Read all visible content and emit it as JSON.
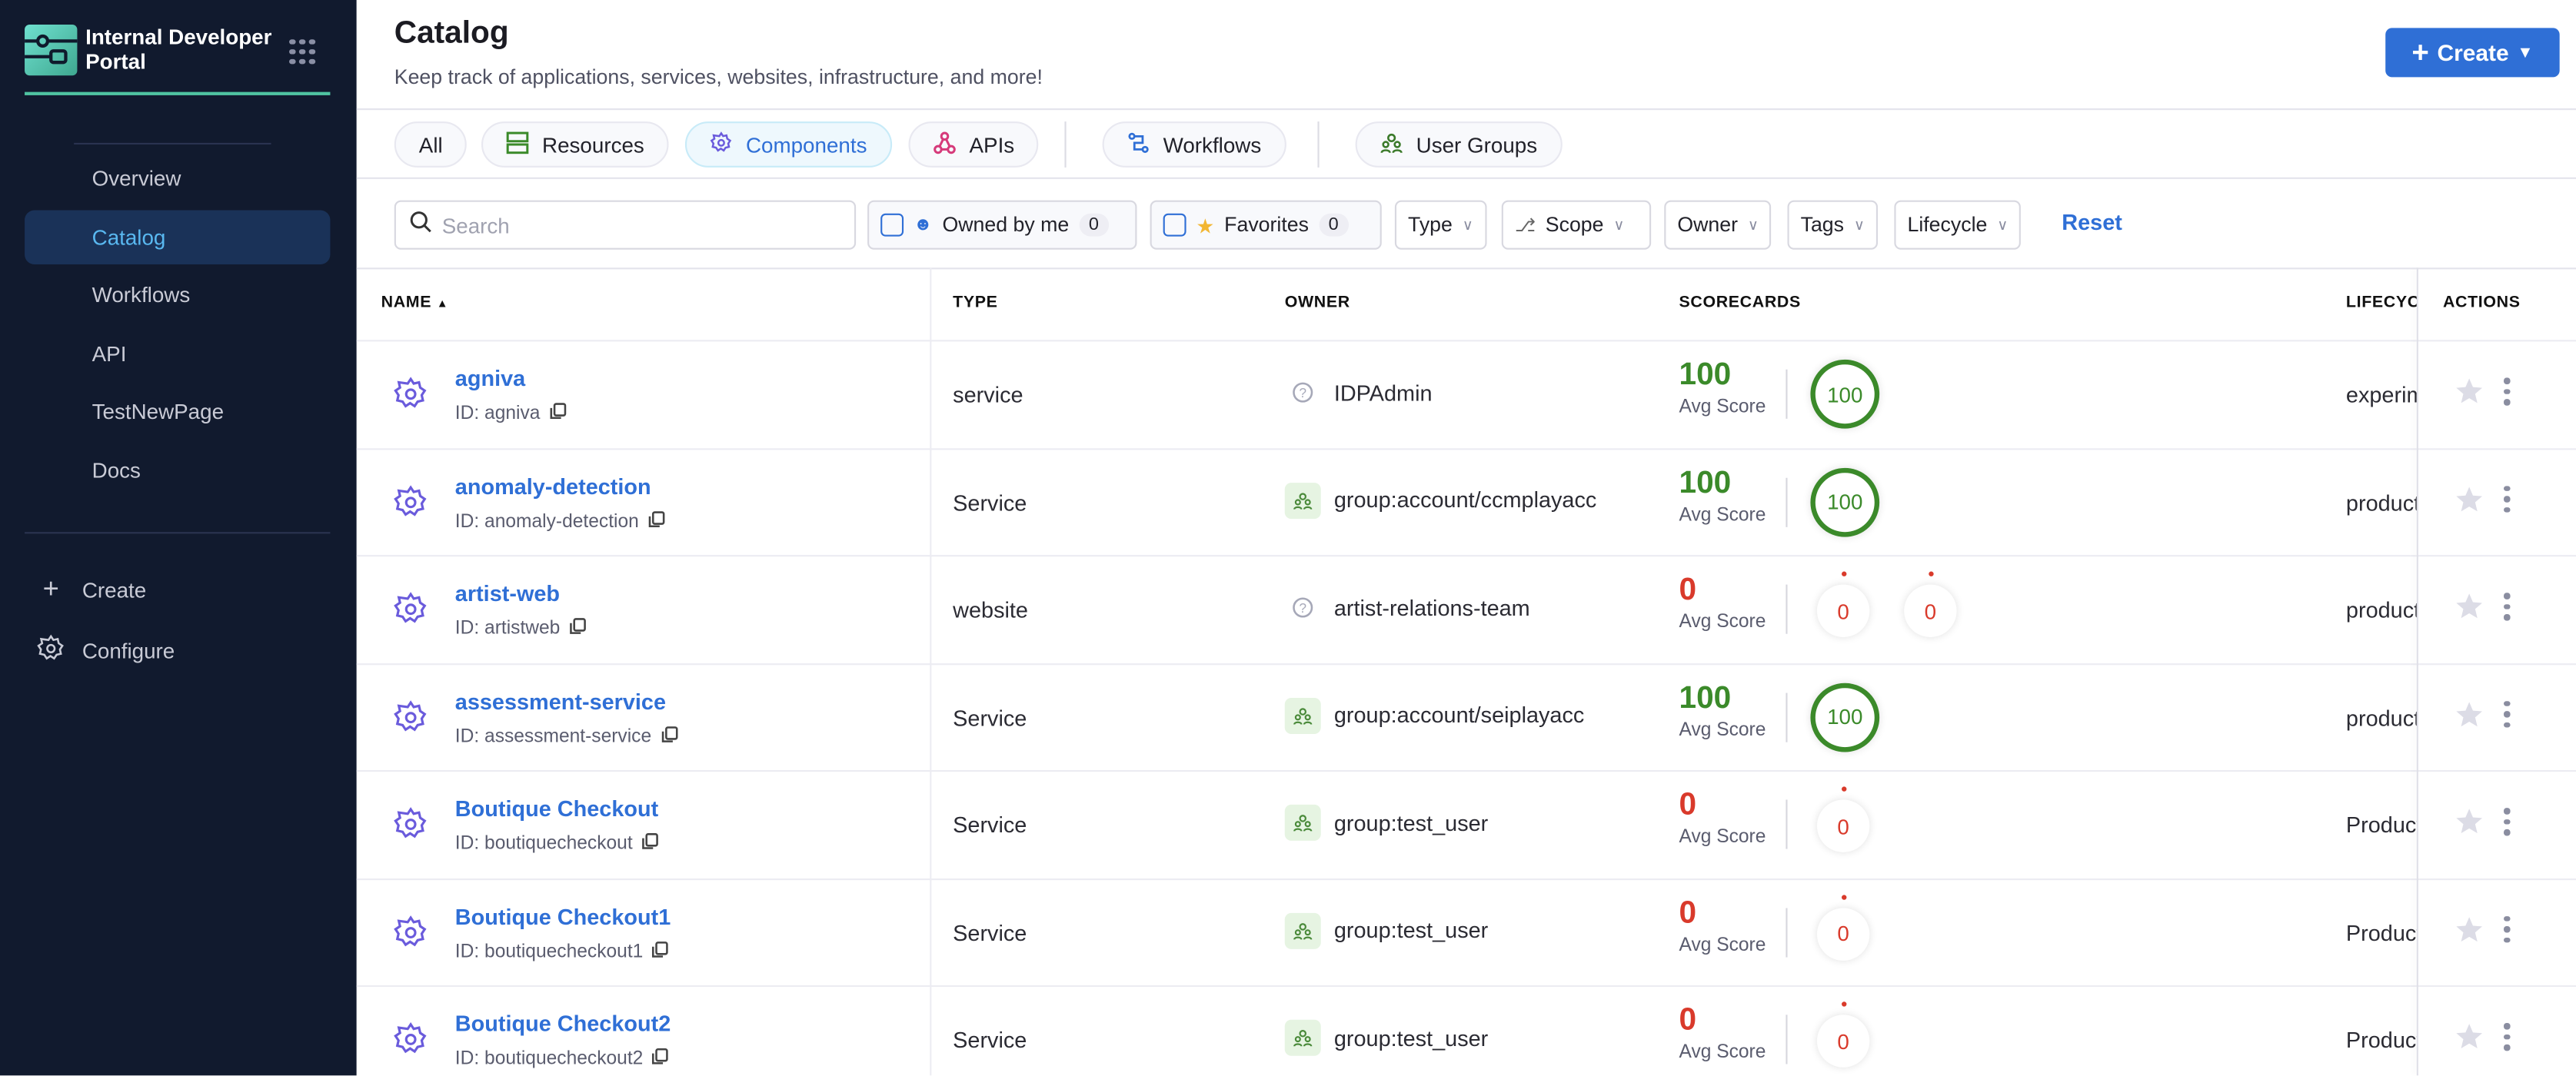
{
  "sidebar": {
    "brand": "Internal Developer Portal",
    "items": [
      {
        "label": "Overview"
      },
      {
        "label": "Catalog",
        "active": true
      },
      {
        "label": "Workflows"
      },
      {
        "label": "API"
      },
      {
        "label": "TestNewPage"
      },
      {
        "label": "Docs"
      }
    ],
    "create_label": "Create",
    "configure_label": "Configure"
  },
  "header": {
    "title": "Catalog",
    "subtitle": "Keep track of applications, services, websites, infrastructure, and more!",
    "create_label": "Create"
  },
  "tabs": [
    {
      "label": "All"
    },
    {
      "label": "Resources",
      "icon": "resources-icon"
    },
    {
      "label": "Components",
      "icon": "gear-icon",
      "active": true
    },
    {
      "label": "APIs",
      "icon": "api-icon"
    },
    {
      "label": "Workflows",
      "icon": "workflow-icon"
    },
    {
      "label": "User Groups",
      "icon": "users-icon"
    }
  ],
  "filters": {
    "search_placeholder": "Search",
    "owned_label": "Owned by me",
    "owned_count": "0",
    "fav_label": "Favorites",
    "fav_count": "0",
    "type": "Type",
    "scope": "Scope",
    "owner": "Owner",
    "tags": "Tags",
    "lifecycle": "Lifecycle",
    "reset": "Reset"
  },
  "table": {
    "columns": {
      "name": "NAME",
      "type": "TYPE",
      "owner": "OWNER",
      "scorecards": "SCORECARDS",
      "lifecycle": "LIFECYC",
      "actions": "ACTIONS"
    },
    "avg_label": "Avg Score",
    "colors": {
      "good": "#3b8a2a",
      "bad": "#d93a2b"
    },
    "rows": [
      {
        "name": "agniva",
        "id": "ID: agniva",
        "type": "service",
        "owner": "IDPAdmin",
        "owner_kind": "unknown",
        "avg": "100",
        "scores": [
          "100"
        ],
        "lifecycle": "experimental"
      },
      {
        "name": "anomaly-detection",
        "id": "ID: anomaly-detection",
        "type": "Service",
        "owner": "group:account/ccmplayacc",
        "owner_kind": "group",
        "avg": "100",
        "scores": [
          "100"
        ],
        "lifecycle": "production"
      },
      {
        "name": "artist-web",
        "id": "ID: artistweb",
        "type": "website",
        "owner": "artist-relations-team",
        "owner_kind": "unknown",
        "avg": "0",
        "scores": [
          "0",
          "0"
        ],
        "lifecycle": "production"
      },
      {
        "name": "assessment-service",
        "id": "ID: assessment-service",
        "type": "Service",
        "owner": "group:account/seiplayacc",
        "owner_kind": "group",
        "avg": "100",
        "scores": [
          "100"
        ],
        "lifecycle": "production"
      },
      {
        "name": "Boutique Checkout",
        "id": "ID: boutiquecheckout",
        "type": "Service",
        "owner": "group:test_user",
        "owner_kind": "group",
        "avg": "0",
        "scores": [
          "0"
        ],
        "lifecycle": "Production"
      },
      {
        "name": "Boutique Checkout1",
        "id": "ID: boutiquecheckout1",
        "type": "Service",
        "owner": "group:test_user",
        "owner_kind": "group",
        "avg": "0",
        "scores": [
          "0"
        ],
        "lifecycle": "Production"
      },
      {
        "name": "Boutique Checkout2",
        "id": "ID: boutiquecheckout2",
        "type": "Service",
        "owner": "group:test_user",
        "owner_kind": "group",
        "avg": "0",
        "scores": [
          "0"
        ],
        "lifecycle": "Production"
      }
    ]
  }
}
